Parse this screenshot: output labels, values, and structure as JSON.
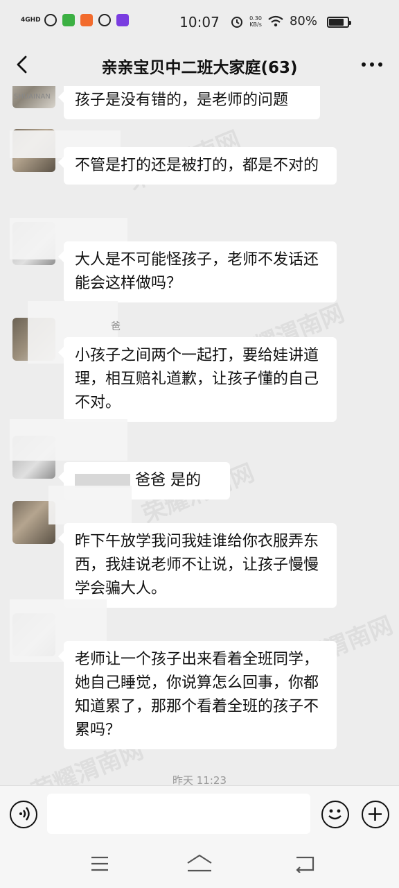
{
  "status_bar": {
    "network": "4GHD",
    "time": "10:07",
    "speed_value": "0.30",
    "speed_unit": "KB/s",
    "battery_percent": "80%",
    "battery_level": 0.8
  },
  "header": {
    "title": "亲亲宝贝中二班大家庭(63)"
  },
  "messages": [
    {
      "sender": "SHUAINAN",
      "text": "孩子是没有错的，是老师的问题"
    },
    {
      "sender": "",
      "text": "不管是打的还是被打的，都是不对的"
    },
    {
      "sender": "",
      "text": "大人是不可能怪孩子，老师不发话还能会这样做吗？"
    },
    {
      "sender": "爸",
      "text": "小孩子之间两个一起打，要给娃讲道理，相互赔礼道歉，让孩子懂的自己不对。"
    },
    {
      "sender": "",
      "text": "爸爸  是的"
    },
    {
      "sender": "",
      "text": "昨下午放学我问我娃谁给你衣服弄东西，我娃说老师不让说，让孩子慢慢学会骗大人。"
    },
    {
      "sender": "",
      "text": "老师让一个孩子出来看着全班同学，她自己睡觉，你说算怎么回事，你都知道累了，那那个看着全班的孩子不累吗？"
    }
  ],
  "timestamp": "昨天 11:23",
  "watermark": "荣耀渭南网",
  "icons": {
    "back": "chevron-left-icon",
    "more": "more-dots-icon",
    "voice": "voice-icon",
    "emoji": "emoji-icon",
    "plus": "plus-icon"
  }
}
